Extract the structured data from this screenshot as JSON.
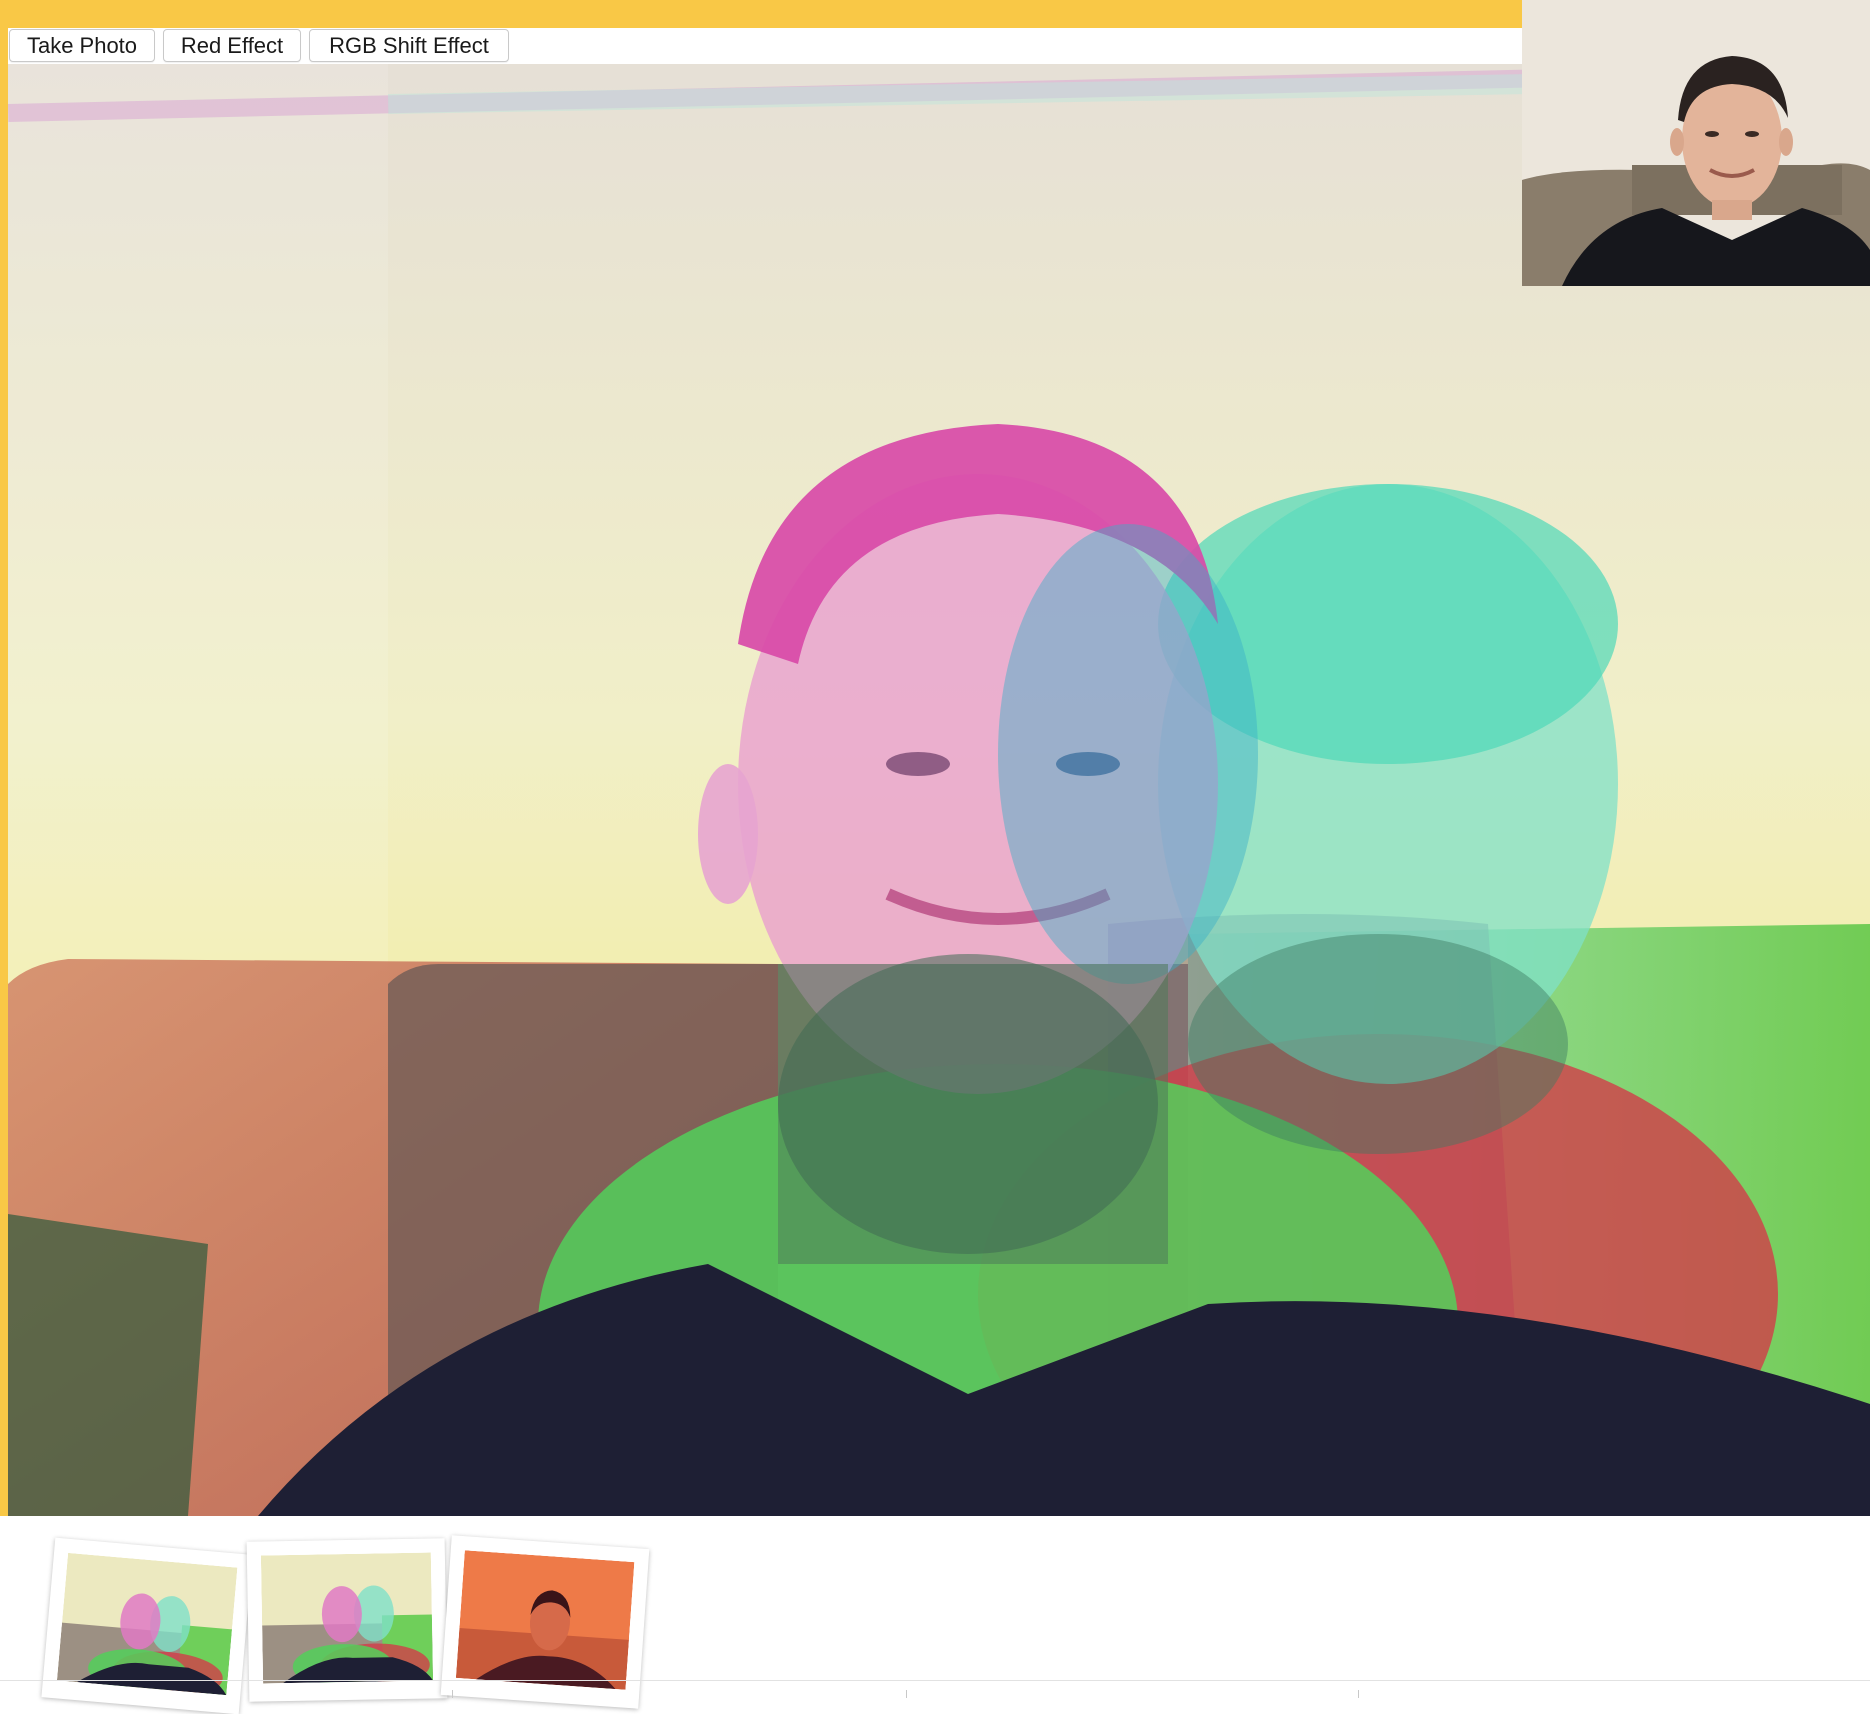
{
  "toolbar": {
    "take_photo_label": "Take Photo",
    "red_effect_label": "Red Effect",
    "rgb_shift_label": "RGB Shift Effect"
  },
  "colors": {
    "accent": "#f9c846",
    "magenta_channel": "#d94bb2",
    "cyan_channel": "#6ad8c0",
    "green_channel": "#5fd06a",
    "red_channel": "#d84a4a",
    "shirt": "#1e1f34",
    "red_effect_tint": "#ee7a48"
  },
  "gallery": {
    "photos": [
      {
        "effect": "rgb-shift"
      },
      {
        "effect": "rgb-shift"
      },
      {
        "effect": "red"
      }
    ]
  }
}
